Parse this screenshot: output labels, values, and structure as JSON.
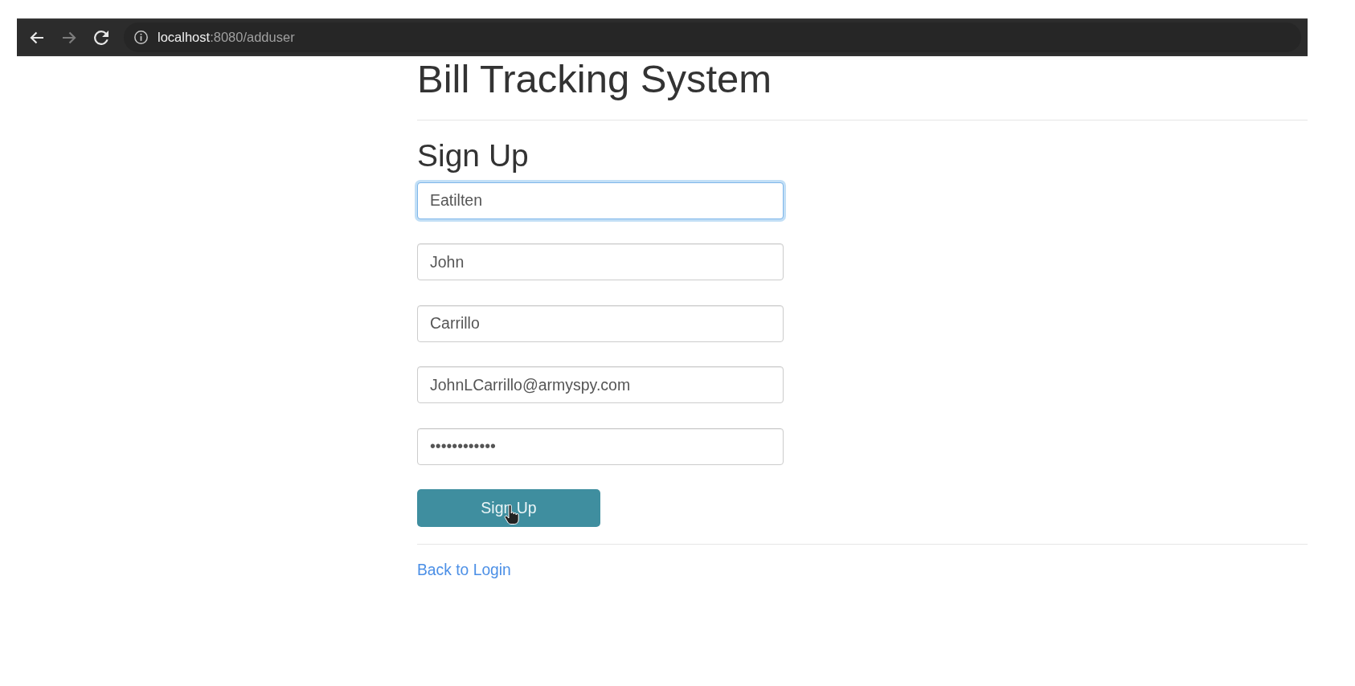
{
  "browser": {
    "nav_buttons": [
      {
        "kind": "back",
        "disabled": false
      },
      {
        "kind": "forward",
        "disabled": true
      },
      {
        "kind": "reload",
        "disabled": false
      }
    ],
    "address": {
      "host": "localhost",
      "path": ":8080/adduser"
    }
  },
  "page": {
    "title": "Bill Tracking System",
    "form_title": "Sign Up",
    "fields": [
      {
        "value": "Eatilten",
        "focused": true
      },
      {
        "value": "John",
        "focused": false
      },
      {
        "value": "Carrillo",
        "focused": false
      },
      {
        "value": "JohnLCarrillo@armyspy.com",
        "focused": false
      },
      {
        "value": "••••••••••••",
        "focused": false
      }
    ],
    "submit_button": "Sign Up",
    "back_link": "Back to Login"
  }
}
